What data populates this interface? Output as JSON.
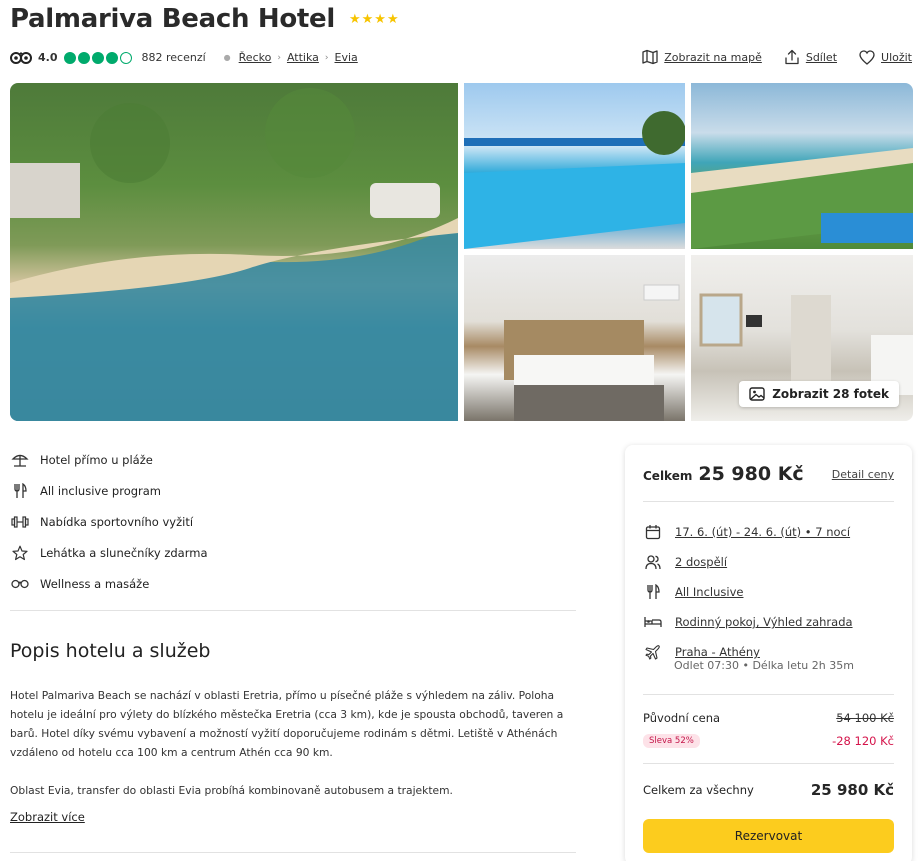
{
  "hotel": {
    "name": "Palmariva Beach Hotel",
    "stars": "★★★★",
    "rating": "4.0",
    "bubbles_filled": 4,
    "bubbles_total": 5,
    "reviews": "882 recenzí",
    "breadcrumb": [
      "Řecko",
      "Attika",
      "Evia"
    ]
  },
  "actions": {
    "map": "Zobrazit na mapě",
    "share": "Sdílet",
    "save": "Uložit"
  },
  "gallery": {
    "show_photos": "Zobrazit 28 fotek"
  },
  "features": [
    {
      "icon": "beach-umbrella-icon",
      "label": "Hotel přímo u pláže"
    },
    {
      "icon": "fork-knife-icon",
      "label": "All inclusive program"
    },
    {
      "icon": "dumbbell-icon",
      "label": "Nabídka sportovního vyžití"
    },
    {
      "icon": "star-outline-icon",
      "label": "Lehátka a slunečníky zdarma"
    },
    {
      "icon": "wellness-icon",
      "label": "Wellness a masáže"
    }
  ],
  "description": {
    "title": "Popis hotelu a služeb",
    "paragraph1": "Hotel Palmariva Beach se nachází v oblasti Eretria, přímo u písečné pláže s výhledem na záliv. Poloha hotelu je ideální pro výlety do blízkého městečka Eretria (cca 3 km), kde je spousta obchodů, taveren a barů. Hotel díky svému vybavení a možností vyžití doporučujeme rodinám s dětmi. Letiště v Athénách vzdáleno od hotelu cca 100 km a centrum Athén cca 90 km.",
    "paragraph2": "Oblast Evia, transfer do oblasti Evia probíhá kombinovaně autobusem a trajektem.",
    "more": "Zobrazit více"
  },
  "booking": {
    "total_label": "Celkem",
    "total_value": "25 980 Kč",
    "price_detail": "Detail ceny",
    "dates": "17. 6. (út) - 24. 6. (út) • 7 nocí",
    "people": "2 dospělí",
    "board": "All Inclusive",
    "room": "Rodinný pokoj, Výhled zahrada",
    "flight": "Praha - Athény",
    "flight_info": "Odlet 07:30 • Délka letu 2h 35m",
    "original_label": "Původní cena",
    "original_value": "54 100 Kč",
    "discount_badge": "Sleva 52%",
    "discount_value": "-28 120 Kč",
    "grand_label": "Celkem za všechny",
    "grand_value": "25 980 Kč",
    "book_button": "Rezervovat"
  },
  "colors": {
    "accent_yellow": "#fccc1e",
    "tripadvisor_green": "#00aa6c",
    "discount_red": "#d5134a"
  }
}
